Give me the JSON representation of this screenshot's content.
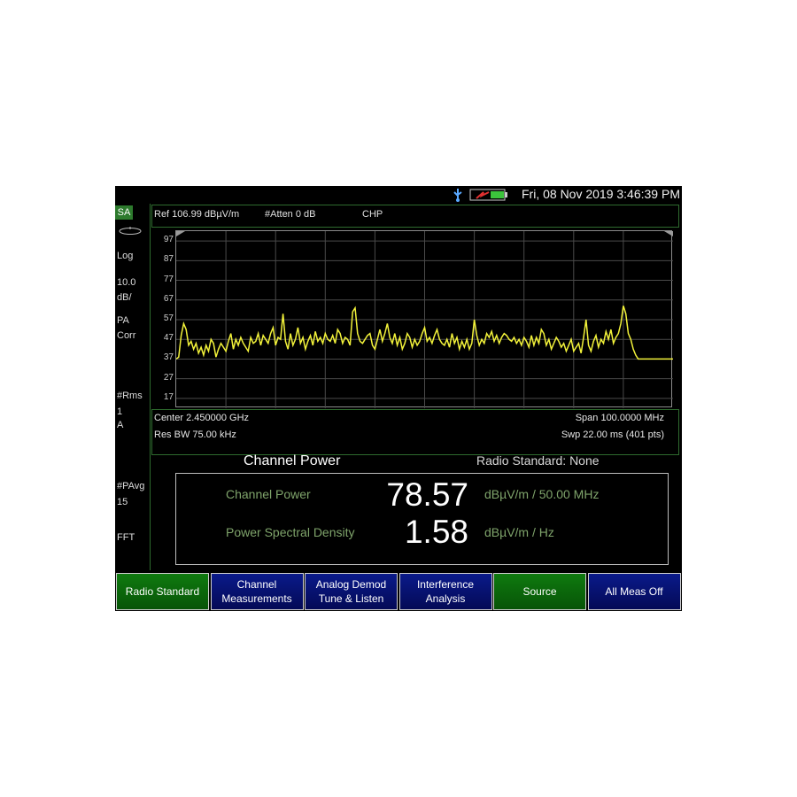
{
  "status": {
    "datetime": "Fri, 08 Nov 2019 3:46:39 PM",
    "icons": [
      "usb-icon",
      "battery-icon"
    ],
    "battery_color": "#3cc33c"
  },
  "left_panel": {
    "mode": "SA",
    "scale_type": "Log",
    "scale_value": "10.0",
    "scale_unit": "dB/",
    "preamp_line1": "PA",
    "preamp_line2": "Corr",
    "detector": "#Rms",
    "trace_num": "1",
    "trace_mode": "A",
    "avg_label": "#PAvg",
    "avg_count": "15",
    "sweep_type": "FFT",
    "icons": [
      "trace-marker-icon"
    ]
  },
  "header": {
    "ref": "Ref 106.99 dBµV/m",
    "atten": "#Atten 0 dB",
    "measurement": "CHP"
  },
  "freq_info": {
    "center": "Center 2.450000 GHz",
    "res_bw": "Res BW 75.00 kHz",
    "span": "Span 100.0000 MHz",
    "sweep": "Swp 22.00 ms (401 pts)"
  },
  "results": {
    "title": "Channel Power",
    "radio_standard": "Radio Standard: None",
    "channel_power_label": "Channel Power",
    "channel_power_value": "78.57",
    "channel_power_unit": "dBµV/m / 50.00 MHz",
    "psd_label": "Power Spectral Density",
    "psd_value": "1.58",
    "psd_unit": "dBµV/m / Hz"
  },
  "softkeys": [
    {
      "label": "Radio Standard",
      "style": "green"
    },
    {
      "label": "Channel\nMeasurements",
      "style": "blue"
    },
    {
      "label": "Analog Demod\nTune & Listen",
      "style": "blue"
    },
    {
      "label": "Interference\nAnalysis",
      "style": "blue"
    },
    {
      "label": "Source",
      "style": "green"
    },
    {
      "label": "All Meas Off",
      "style": "blue"
    }
  ],
  "chart_data": {
    "type": "line",
    "ylim": [
      12,
      102
    ],
    "yticks": [
      97,
      87,
      77,
      67,
      57,
      47,
      37,
      27,
      17
    ],
    "xlim": [
      2400,
      2500
    ],
    "grid": true,
    "trace_color": "#f2f23a",
    "series": [
      {
        "x": [
          2400,
          2400.5,
          2401,
          2401.5,
          2402,
          2402.5,
          2403,
          2403.5,
          2404,
          2404.5,
          2405,
          2405.5,
          2406,
          2406.5,
          2407,
          2407.5,
          2408,
          2408.5,
          2409,
          2409.5,
          2410,
          2410.5,
          2411,
          2411.5,
          2412,
          2412.5,
          2413,
          2413.5,
          2414,
          2414.5,
          2415,
          2415.5,
          2416,
          2416.5,
          2417,
          2417.5,
          2418,
          2418.5,
          2419,
          2419.5,
          2420,
          2420.5,
          2421,
          2421.5,
          2422,
          2422.5,
          2423,
          2423.5,
          2424,
          2424.5,
          2425,
          2425.5,
          2426,
          2426.5,
          2427,
          2427.5,
          2428,
          2428.5,
          2429,
          2429.5,
          2430,
          2430.5,
          2431,
          2431.5,
          2432,
          2432.5,
          2433,
          2433.5,
          2434,
          2434.5,
          2435,
          2435.5,
          2436,
          2436.5,
          2437,
          2437.5,
          2438,
          2438.5,
          2439,
          2439.5,
          2440,
          2440.5,
          2441,
          2441.5,
          2442,
          2442.5,
          2443,
          2443.5,
          2444,
          2444.5,
          2445,
          2445.5,
          2446,
          2446.5,
          2447,
          2447.5,
          2448,
          2448.5,
          2449,
          2449.5,
          2450,
          2450.5,
          2451,
          2451.5,
          2452,
          2452.5,
          2453,
          2453.5,
          2454,
          2454.5,
          2455,
          2455.5,
          2456,
          2456.5,
          2457,
          2457.5,
          2458,
          2458.5,
          2459,
          2459.5,
          2460,
          2460.5,
          2461,
          2461.5,
          2462,
          2462.5,
          2463,
          2463.5,
          2464,
          2464.5,
          2465,
          2465.5,
          2466,
          2466.5,
          2467,
          2467.5,
          2468,
          2468.5,
          2469,
          2469.5,
          2470,
          2470.5,
          2471,
          2471.5,
          2472,
          2472.5,
          2473,
          2473.5,
          2474,
          2474.5,
          2475,
          2475.5,
          2476,
          2476.5,
          2477,
          2477.5,
          2478,
          2478.5,
          2479,
          2479.5,
          2480,
          2480.5,
          2481,
          2481.5,
          2482,
          2482.5,
          2483,
          2483.5,
          2484,
          2484.5,
          2485,
          2485.5,
          2486,
          2486.5,
          2487,
          2487.5,
          2488,
          2488.5,
          2489,
          2489.5,
          2490,
          2490.5,
          2491,
          2491.5,
          2492,
          2492.5,
          2493,
          2493.5,
          2494,
          2494.5,
          2495,
          2495.5,
          2496,
          2496.5,
          2497,
          2497.5,
          2498,
          2498.5,
          2499,
          2499.5,
          2500
        ],
        "y": [
          37,
          38,
          49,
          55,
          52,
          44,
          46,
          42,
          45,
          40,
          43,
          39,
          44,
          41,
          47,
          45,
          38,
          42,
          45,
          43,
          41,
          46,
          50,
          42,
          47,
          44,
          48,
          45,
          43,
          41,
          48,
          45,
          46,
          50,
          44,
          49,
          47,
          45,
          50,
          53,
          44,
          48,
          47,
          60,
          46,
          42,
          50,
          44,
          47,
          53,
          45,
          48,
          42,
          46,
          49,
          44,
          51,
          46,
          48,
          45,
          50,
          47,
          46,
          49,
          45,
          52,
          50,
          45,
          48,
          47,
          44,
          61,
          63,
          50,
          46,
          45,
          47,
          49,
          50,
          44,
          42,
          47,
          52,
          46,
          50,
          55,
          48,
          45,
          50,
          44,
          48,
          42,
          45,
          50,
          48,
          43,
          47,
          44,
          46,
          50,
          53,
          46,
          48,
          45,
          49,
          52,
          47,
          45,
          44,
          47,
          43,
          50,
          45,
          48,
          42,
          46,
          43,
          47,
          42,
          45,
          57,
          49,
          44,
          47,
          45,
          50,
          48,
          51,
          46,
          49,
          45,
          48,
          50,
          49,
          47,
          46,
          48,
          45,
          47,
          44,
          48,
          46,
          43,
          49,
          44,
          48,
          45,
          52,
          50,
          44,
          47,
          42,
          45,
          48,
          46,
          43,
          45,
          41,
          44,
          47,
          41,
          43,
          45,
          40,
          48,
          57,
          44,
          41,
          46,
          49,
          43,
          47,
          45,
          51,
          47,
          52,
          45,
          48,
          50,
          55,
          64,
          60,
          50,
          47,
          42,
          39,
          37,
          37,
          37,
          37,
          37,
          37,
          37,
          37,
          37,
          37,
          37,
          37,
          37,
          37,
          37
        ]
      }
    ]
  }
}
